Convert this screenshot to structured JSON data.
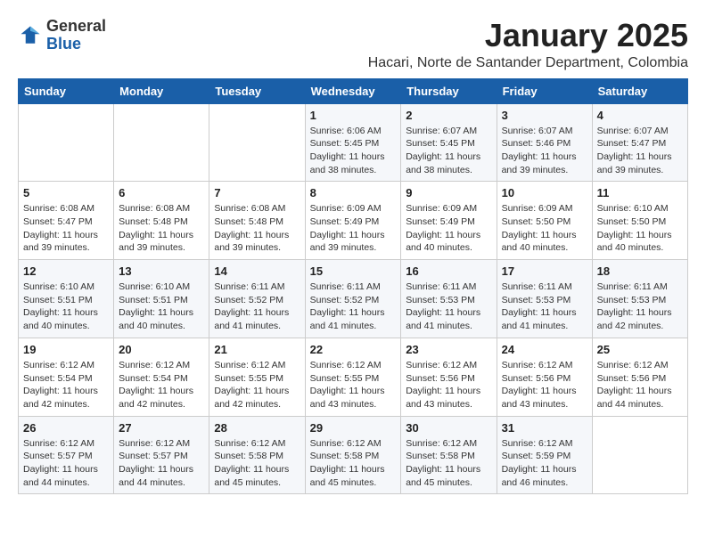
{
  "header": {
    "logo_general": "General",
    "logo_blue": "Blue",
    "month_title": "January 2025",
    "location": "Hacari, Norte de Santander Department, Colombia"
  },
  "weekdays": [
    "Sunday",
    "Monday",
    "Tuesday",
    "Wednesday",
    "Thursday",
    "Friday",
    "Saturday"
  ],
  "weeks": [
    [
      {
        "day": "",
        "info": ""
      },
      {
        "day": "",
        "info": ""
      },
      {
        "day": "",
        "info": ""
      },
      {
        "day": "1",
        "info": "Sunrise: 6:06 AM\nSunset: 5:45 PM\nDaylight: 11 hours\nand 38 minutes."
      },
      {
        "day": "2",
        "info": "Sunrise: 6:07 AM\nSunset: 5:45 PM\nDaylight: 11 hours\nand 38 minutes."
      },
      {
        "day": "3",
        "info": "Sunrise: 6:07 AM\nSunset: 5:46 PM\nDaylight: 11 hours\nand 39 minutes."
      },
      {
        "day": "4",
        "info": "Sunrise: 6:07 AM\nSunset: 5:47 PM\nDaylight: 11 hours\nand 39 minutes."
      }
    ],
    [
      {
        "day": "5",
        "info": "Sunrise: 6:08 AM\nSunset: 5:47 PM\nDaylight: 11 hours\nand 39 minutes."
      },
      {
        "day": "6",
        "info": "Sunrise: 6:08 AM\nSunset: 5:48 PM\nDaylight: 11 hours\nand 39 minutes."
      },
      {
        "day": "7",
        "info": "Sunrise: 6:08 AM\nSunset: 5:48 PM\nDaylight: 11 hours\nand 39 minutes."
      },
      {
        "day": "8",
        "info": "Sunrise: 6:09 AM\nSunset: 5:49 PM\nDaylight: 11 hours\nand 39 minutes."
      },
      {
        "day": "9",
        "info": "Sunrise: 6:09 AM\nSunset: 5:49 PM\nDaylight: 11 hours\nand 40 minutes."
      },
      {
        "day": "10",
        "info": "Sunrise: 6:09 AM\nSunset: 5:50 PM\nDaylight: 11 hours\nand 40 minutes."
      },
      {
        "day": "11",
        "info": "Sunrise: 6:10 AM\nSunset: 5:50 PM\nDaylight: 11 hours\nand 40 minutes."
      }
    ],
    [
      {
        "day": "12",
        "info": "Sunrise: 6:10 AM\nSunset: 5:51 PM\nDaylight: 11 hours\nand 40 minutes."
      },
      {
        "day": "13",
        "info": "Sunrise: 6:10 AM\nSunset: 5:51 PM\nDaylight: 11 hours\nand 40 minutes."
      },
      {
        "day": "14",
        "info": "Sunrise: 6:11 AM\nSunset: 5:52 PM\nDaylight: 11 hours\nand 41 minutes."
      },
      {
        "day": "15",
        "info": "Sunrise: 6:11 AM\nSunset: 5:52 PM\nDaylight: 11 hours\nand 41 minutes."
      },
      {
        "day": "16",
        "info": "Sunrise: 6:11 AM\nSunset: 5:53 PM\nDaylight: 11 hours\nand 41 minutes."
      },
      {
        "day": "17",
        "info": "Sunrise: 6:11 AM\nSunset: 5:53 PM\nDaylight: 11 hours\nand 41 minutes."
      },
      {
        "day": "18",
        "info": "Sunrise: 6:11 AM\nSunset: 5:53 PM\nDaylight: 11 hours\nand 42 minutes."
      }
    ],
    [
      {
        "day": "19",
        "info": "Sunrise: 6:12 AM\nSunset: 5:54 PM\nDaylight: 11 hours\nand 42 minutes."
      },
      {
        "day": "20",
        "info": "Sunrise: 6:12 AM\nSunset: 5:54 PM\nDaylight: 11 hours\nand 42 minutes."
      },
      {
        "day": "21",
        "info": "Sunrise: 6:12 AM\nSunset: 5:55 PM\nDaylight: 11 hours\nand 42 minutes."
      },
      {
        "day": "22",
        "info": "Sunrise: 6:12 AM\nSunset: 5:55 PM\nDaylight: 11 hours\nand 43 minutes."
      },
      {
        "day": "23",
        "info": "Sunrise: 6:12 AM\nSunset: 5:56 PM\nDaylight: 11 hours\nand 43 minutes."
      },
      {
        "day": "24",
        "info": "Sunrise: 6:12 AM\nSunset: 5:56 PM\nDaylight: 11 hours\nand 43 minutes."
      },
      {
        "day": "25",
        "info": "Sunrise: 6:12 AM\nSunset: 5:56 PM\nDaylight: 11 hours\nand 44 minutes."
      }
    ],
    [
      {
        "day": "26",
        "info": "Sunrise: 6:12 AM\nSunset: 5:57 PM\nDaylight: 11 hours\nand 44 minutes."
      },
      {
        "day": "27",
        "info": "Sunrise: 6:12 AM\nSunset: 5:57 PM\nDaylight: 11 hours\nand 44 minutes."
      },
      {
        "day": "28",
        "info": "Sunrise: 6:12 AM\nSunset: 5:58 PM\nDaylight: 11 hours\nand 45 minutes."
      },
      {
        "day": "29",
        "info": "Sunrise: 6:12 AM\nSunset: 5:58 PM\nDaylight: 11 hours\nand 45 minutes."
      },
      {
        "day": "30",
        "info": "Sunrise: 6:12 AM\nSunset: 5:58 PM\nDaylight: 11 hours\nand 45 minutes."
      },
      {
        "day": "31",
        "info": "Sunrise: 6:12 AM\nSunset: 5:59 PM\nDaylight: 11 hours\nand 46 minutes."
      },
      {
        "day": "",
        "info": ""
      }
    ]
  ]
}
